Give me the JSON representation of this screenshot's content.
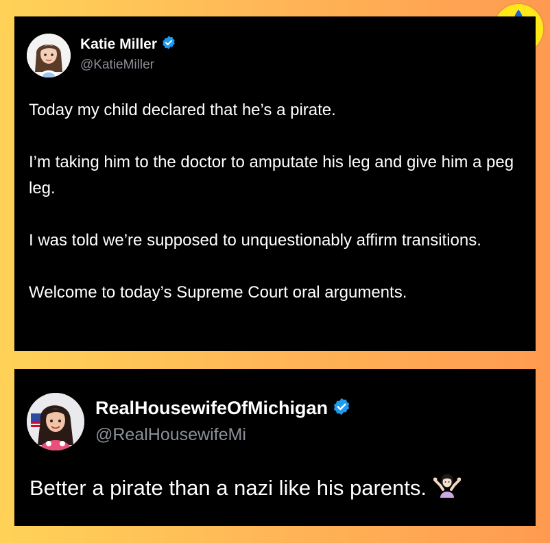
{
  "tweets": [
    {
      "display_name": "Katie Miller",
      "handle": "@KatieMiller",
      "verified": true,
      "paragraphs": [
        "Today my child declared that he’s a pirate.",
        "I’m taking him to the doctor to amputate his leg and give him a peg leg.",
        "I was told we’re supposed to unquestionably affirm transitions.",
        "Welcome to today’s Supreme Court oral arguments."
      ]
    },
    {
      "display_name": "RealHousewifeOfMichigan",
      "handle": "@RealHousewifeMi",
      "verified": true,
      "text": "Better a pirate than a nazi like his parents."
    }
  ],
  "icons": {
    "verified": "verified-badge-icon",
    "emoji": "person-shrugging-emoji",
    "logo": "torch-logo-icon"
  },
  "colors": {
    "card_background": "#000000",
    "verified_blue": "#1d9bf0",
    "handle_gray": "#8b9097",
    "logo_yellow": "#ffe81a",
    "logo_blue": "#1e63c8"
  }
}
